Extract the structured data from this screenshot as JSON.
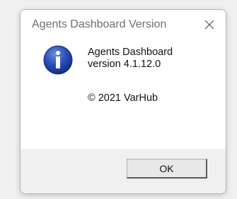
{
  "dialog": {
    "title": "Agents Dashboard Version",
    "close_icon": "close-icon",
    "icon": "information-icon",
    "message_line1": "Agents Dashboard",
    "message_line2": "version 4.1.12.0",
    "copyright": "© 2021 VarHub",
    "ok_label": "OK"
  },
  "colors": {
    "title_text": "#6f6f6f",
    "footer_bg": "#f0f0f0",
    "icon_blue": "#1a3f9e"
  }
}
